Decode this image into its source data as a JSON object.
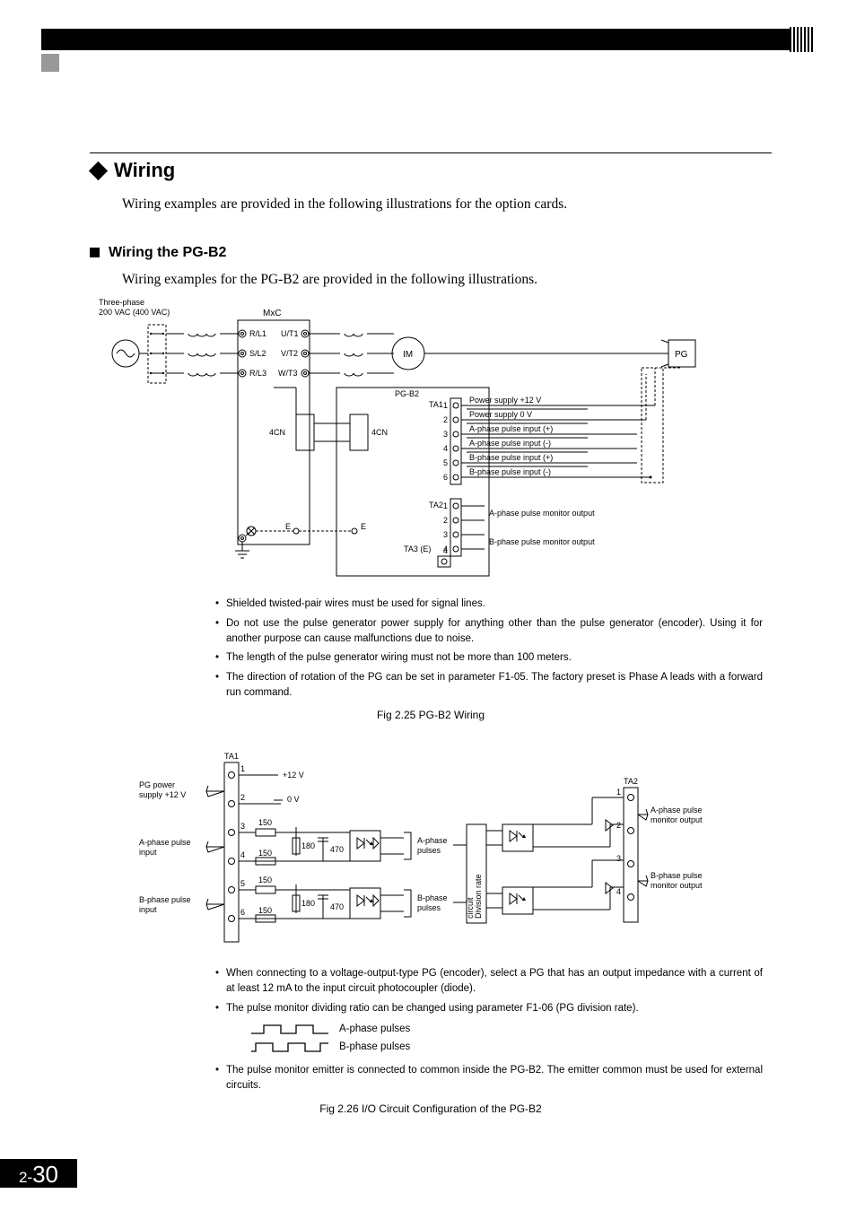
{
  "section_title": "Wiring",
  "intro_text": "Wiring examples are provided in the following illustrations for the option cards.",
  "sub_title": "Wiring the PG-B2",
  "sub_intro": "Wiring examples for the PG-B2 are provided in the following illustrations.",
  "fig1": {
    "source_label": "Three-phase\n200 VAC (400 VAC)",
    "device_label": "MxC",
    "input_terminals": [
      "R/L1",
      "S/L2",
      "R/L3"
    ],
    "output_terminals": [
      "U/T1",
      "V/T2",
      "W/T3"
    ],
    "motor_label": "IM",
    "pg_label": "PG",
    "card_label": "PG-B2",
    "cn_left": "4CN",
    "cn_right": "4CN",
    "e_left": "E",
    "e_right": "E",
    "ta1_label": "TA1",
    "ta2_label": "TA2",
    "ta3_label": "TA3 (E)",
    "ta1_pins": [
      "1",
      "2",
      "3",
      "4",
      "5",
      "6"
    ],
    "ta2_pins": [
      "1",
      "2",
      "3",
      "4"
    ],
    "ta1_signals": [
      "Power supply +12 V",
      "Power supply 0 V",
      "A-phase pulse input (+)",
      "A-phase pulse input (-)",
      "B-phase pulse input (+)",
      "B-phase pulse input (-)"
    ],
    "ta2_signals": [
      "A-phase pulse monitor output",
      "B-phase pulse monitor output"
    ]
  },
  "notes1": [
    "Shielded twisted-pair wires must be used for signal lines.",
    "Do not use the pulse generator power supply for anything other than the pulse generator (encoder). Using it for another purpose can cause malfunctions due to noise.",
    "The length of the pulse generator wiring must not be more than 100 meters.",
    "The direction of rotation of the PG can be set in parameter F1-05. The factory preset is Phase A leads with a forward run command."
  ],
  "caption1": "Fig 2.25  PG-B2 Wiring",
  "fig2": {
    "ta1_label": "TA1",
    "ta2_label": "TA2",
    "left_labels": {
      "power": "PG power\nsupply +12 V",
      "a_in": "A-phase pulse\ninput",
      "b_in": "B-phase pulse\ninput"
    },
    "pin_nums_left": [
      "1",
      "2",
      "3",
      "4",
      "5",
      "6"
    ],
    "pin_voltages": {
      "1": "+12 V",
      "2": "0 V"
    },
    "resistors": {
      "r1": "150",
      "r2": "180",
      "r3": "470"
    },
    "mid_labels": {
      "a": "A-phase\npulses",
      "b": "B-phase\npulses"
    },
    "div_label": "Division rate\ncircuit",
    "right_labels": {
      "a_out": "A-phase pulse\nmonitor output",
      "b_out": "B-phase pulse\nmonitor output"
    },
    "pin_nums_right": [
      "1",
      "2",
      "3",
      "4"
    ]
  },
  "notes2a": [
    "When connecting to a voltage-output-type PG (encoder), select a PG that has an output impedance with a current of at least 12 mA to the input circuit photocoupler (diode).",
    "The pulse monitor dividing ratio can be changed using parameter F1-06 (PG division rate)."
  ],
  "pulse_labels": {
    "a": "A-phase pulses",
    "b": "B-phase pulses"
  },
  "notes2b": [
    "The pulse monitor emitter is connected to common inside the PG-B2. The emitter common must be used for external circuits."
  ],
  "caption2": "Fig 2.26  I/O Circuit Configuration of the PG-B2",
  "page": {
    "chapter": "2-",
    "num": "30"
  }
}
